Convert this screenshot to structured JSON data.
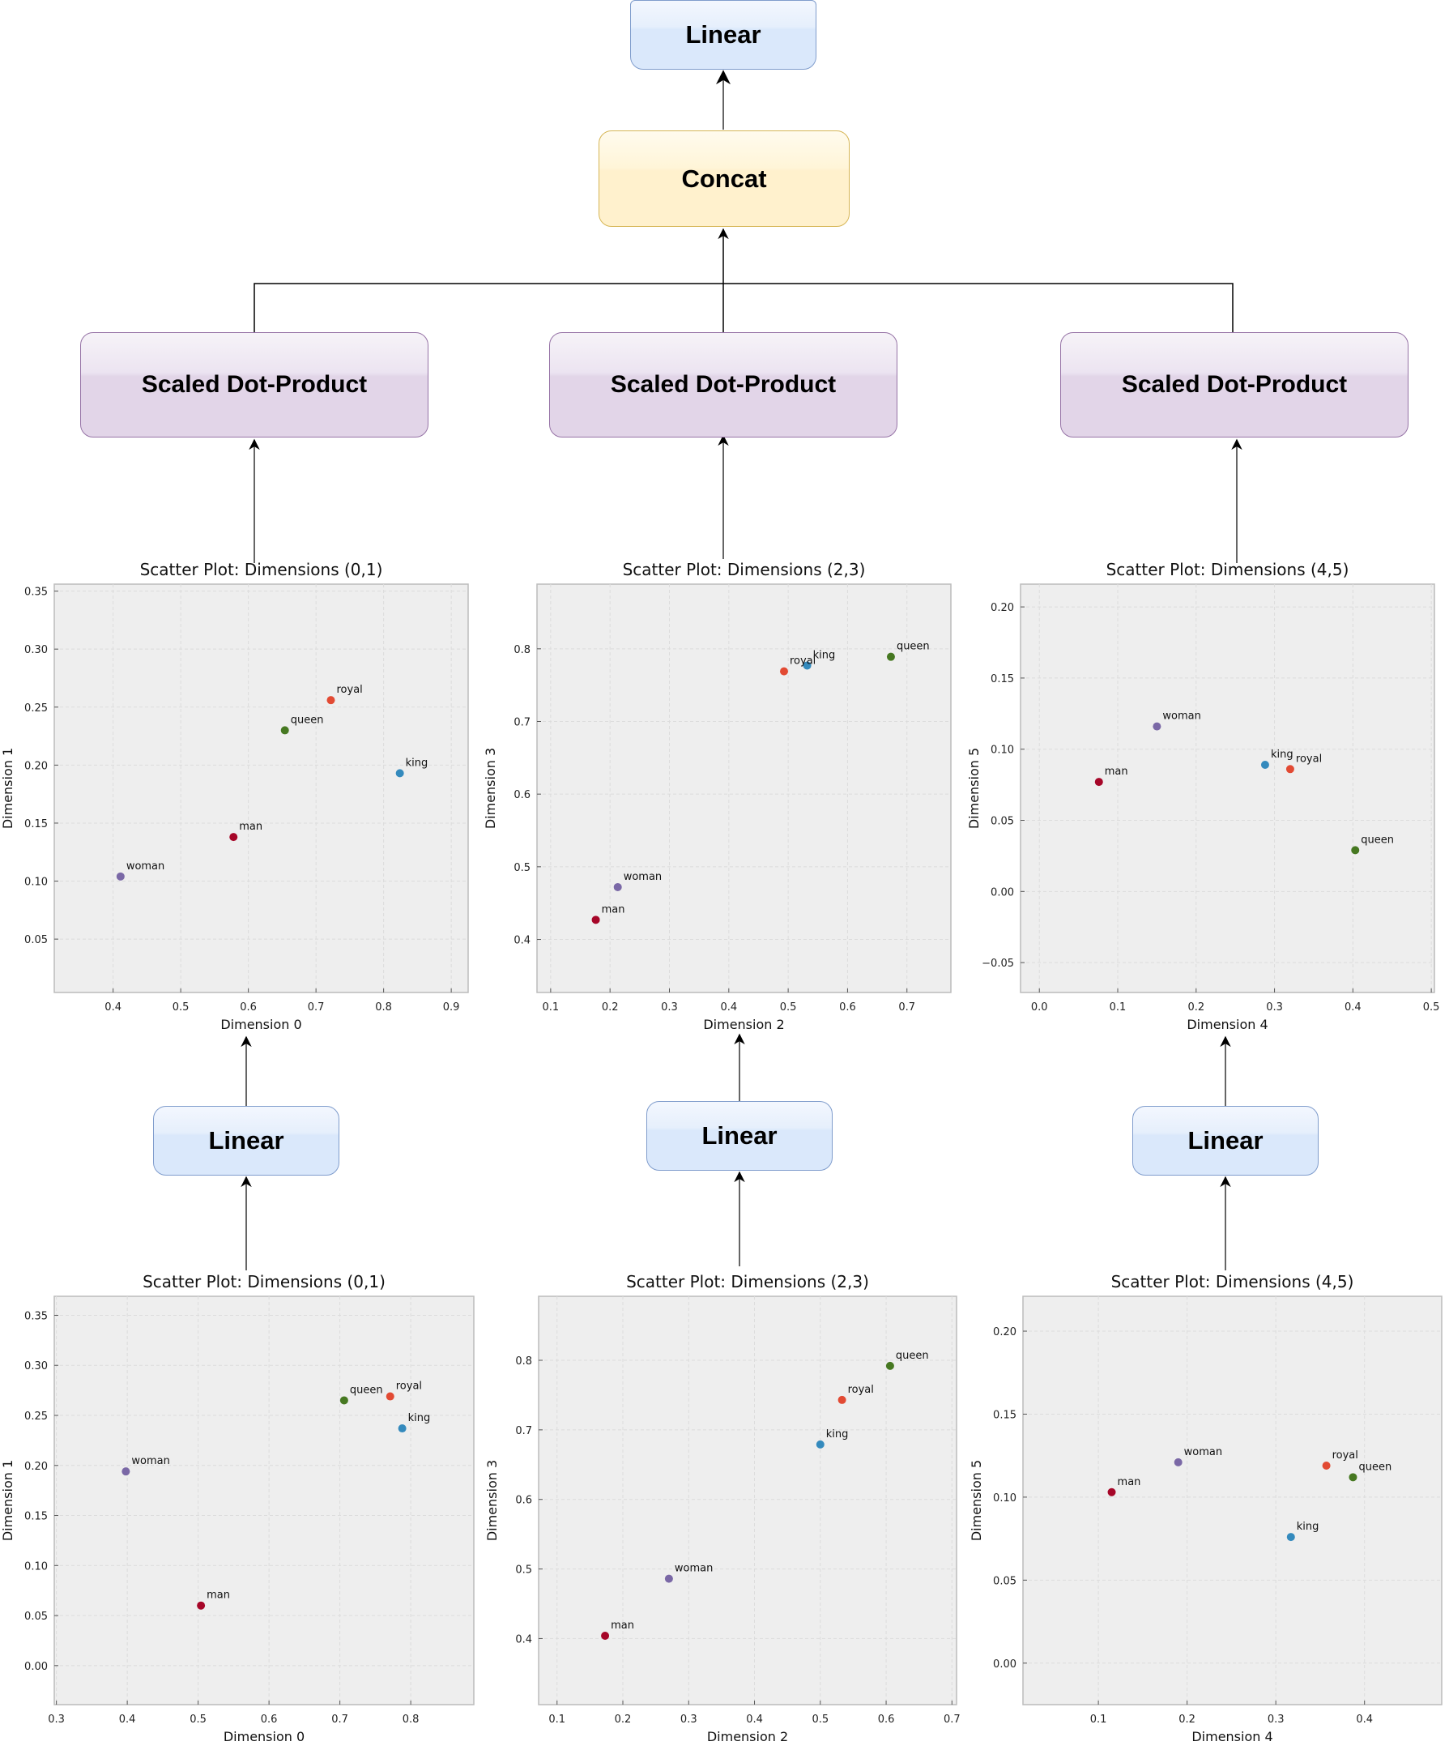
{
  "diagram": {
    "top_linear": {
      "label": "Linear"
    },
    "concat": {
      "label": "Concat"
    },
    "heads": [
      {
        "attention_label": "Scaled Dot-Product",
        "projection_label": "Linear"
      },
      {
        "attention_label": "Scaled Dot-Product",
        "projection_label": "Linear"
      },
      {
        "attention_label": "Scaled Dot-Product",
        "projection_label": "Linear"
      }
    ],
    "colors": {
      "linear_fill": "#dae8fb",
      "linear_border": "#7f9ccc",
      "concat_fill": "#fff1cd",
      "concat_border": "#d6b656",
      "sdp_fill": "#e2d5e8",
      "sdp_border": "#9673a6"
    }
  },
  "word_colors": {
    "king": "#348abd",
    "queen": "#467821",
    "man": "#a60628",
    "woman": "#7a68a6",
    "royal": "#e24a33"
  },
  "chart_data": [
    {
      "type": "scatter",
      "id": "upper-0-1",
      "title": "Scatter Plot: Dimensions (0,1)",
      "xlabel": "Dimension 0",
      "ylabel": "Dimension 1",
      "xlim": [
        0.313,
        0.925
      ],
      "ylim": [
        0.004,
        0.356
      ],
      "xticks": [
        "0.4",
        "0.5",
        "0.6",
        "0.7",
        "0.8",
        "0.9"
      ],
      "yticks": [
        "0.05",
        "0.10",
        "0.15",
        "0.20",
        "0.25",
        "0.30",
        "0.35"
      ],
      "grid": true,
      "points": [
        {
          "label": "king",
          "x": 0.824,
          "y": 0.193
        },
        {
          "label": "queen",
          "x": 0.654,
          "y": 0.23
        },
        {
          "label": "man",
          "x": 0.578,
          "y": 0.138
        },
        {
          "label": "woman",
          "x": 0.411,
          "y": 0.104
        },
        {
          "label": "royal",
          "x": 0.722,
          "y": 0.256
        }
      ]
    },
    {
      "type": "scatter",
      "id": "upper-2-3",
      "title": "Scatter Plot: Dimensions (2,3)",
      "xlabel": "Dimension 2",
      "ylabel": "Dimension 3",
      "xlim": [
        0.077,
        0.774
      ],
      "ylim": [
        0.327,
        0.889
      ],
      "xticks": [
        "0.1",
        "0.2",
        "0.3",
        "0.4",
        "0.5",
        "0.6",
        "0.7"
      ],
      "yticks": [
        "0.4",
        "0.5",
        "0.6",
        "0.7",
        "0.8"
      ],
      "grid": true,
      "points": [
        {
          "label": "king",
          "x": 0.532,
          "y": 0.777
        },
        {
          "label": "queen",
          "x": 0.673,
          "y": 0.789
        },
        {
          "label": "man",
          "x": 0.176,
          "y": 0.427
        },
        {
          "label": "woman",
          "x": 0.213,
          "y": 0.472
        },
        {
          "label": "royal",
          "x": 0.493,
          "y": 0.769
        }
      ]
    },
    {
      "type": "scatter",
      "id": "upper-4-5",
      "title": "Scatter Plot: Dimensions (4,5)",
      "xlabel": "Dimension 4",
      "ylabel": "Dimension 5",
      "xlim": [
        -0.024,
        0.504
      ],
      "ylim": [
        -0.071,
        0.216
      ],
      "xticks": [
        "0.0",
        "0.1",
        "0.2",
        "0.3",
        "0.4",
        "0.5"
      ],
      "yticks": [
        "−0.05",
        "0.00",
        "0.05",
        "0.10",
        "0.15",
        "0.20"
      ],
      "grid": true,
      "points": [
        {
          "label": "king",
          "x": 0.288,
          "y": 0.089
        },
        {
          "label": "queen",
          "x": 0.403,
          "y": 0.029
        },
        {
          "label": "man",
          "x": 0.076,
          "y": 0.077
        },
        {
          "label": "woman",
          "x": 0.15,
          "y": 0.116
        },
        {
          "label": "royal",
          "x": 0.32,
          "y": 0.086
        }
      ]
    },
    {
      "type": "scatter",
      "id": "lower-0-1",
      "title": "Scatter Plot: Dimensions (0,1)",
      "xlabel": "Dimension 0",
      "ylabel": "Dimension 1",
      "xlim": [
        0.297,
        0.889
      ],
      "ylim": [
        -0.039,
        0.369
      ],
      "xticks": [
        "0.3",
        "0.4",
        "0.5",
        "0.6",
        "0.7",
        "0.8"
      ],
      "yticks": [
        "0.00",
        "0.05",
        "0.10",
        "0.15",
        "0.20",
        "0.25",
        "0.30",
        "0.35"
      ],
      "grid": true,
      "points": [
        {
          "label": "king",
          "x": 0.788,
          "y": 0.237
        },
        {
          "label": "queen",
          "x": 0.706,
          "y": 0.265
        },
        {
          "label": "man",
          "x": 0.504,
          "y": 0.06
        },
        {
          "label": "woman",
          "x": 0.398,
          "y": 0.194
        },
        {
          "label": "royal",
          "x": 0.771,
          "y": 0.269
        }
      ]
    },
    {
      "type": "scatter",
      "id": "lower-2-3",
      "title": "Scatter Plot: Dimensions (2,3)",
      "xlabel": "Dimension 2",
      "ylabel": "Dimension 3",
      "xlim": [
        0.072,
        0.707
      ],
      "ylim": [
        0.305,
        0.892
      ],
      "xticks": [
        "0.1",
        "0.2",
        "0.3",
        "0.4",
        "0.5",
        "0.6",
        "0.7"
      ],
      "yticks": [
        "0.4",
        "0.5",
        "0.6",
        "0.7",
        "0.8"
      ],
      "grid": true,
      "points": [
        {
          "label": "king",
          "x": 0.5,
          "y": 0.679
        },
        {
          "label": "queen",
          "x": 0.606,
          "y": 0.792
        },
        {
          "label": "man",
          "x": 0.173,
          "y": 0.404
        },
        {
          "label": "woman",
          "x": 0.27,
          "y": 0.486
        },
        {
          "label": "royal",
          "x": 0.533,
          "y": 0.743
        }
      ]
    },
    {
      "type": "scatter",
      "id": "lower-4-5",
      "title": "Scatter Plot: Dimensions (4,5)",
      "xlabel": "Dimension 4",
      "ylabel": "Dimension 5",
      "xlim": [
        0.015,
        0.487
      ],
      "ylim": [
        -0.025,
        0.221
      ],
      "xticks": [
        "0.1",
        "0.2",
        "0.3",
        "0.4"
      ],
      "yticks": [
        "0.00",
        "0.05",
        "0.10",
        "0.15",
        "0.20"
      ],
      "grid": true,
      "points": [
        {
          "label": "king",
          "x": 0.317,
          "y": 0.076
        },
        {
          "label": "queen",
          "x": 0.387,
          "y": 0.112
        },
        {
          "label": "man",
          "x": 0.115,
          "y": 0.103
        },
        {
          "label": "woman",
          "x": 0.19,
          "y": 0.121
        },
        {
          "label": "royal",
          "x": 0.357,
          "y": 0.119
        }
      ]
    }
  ]
}
